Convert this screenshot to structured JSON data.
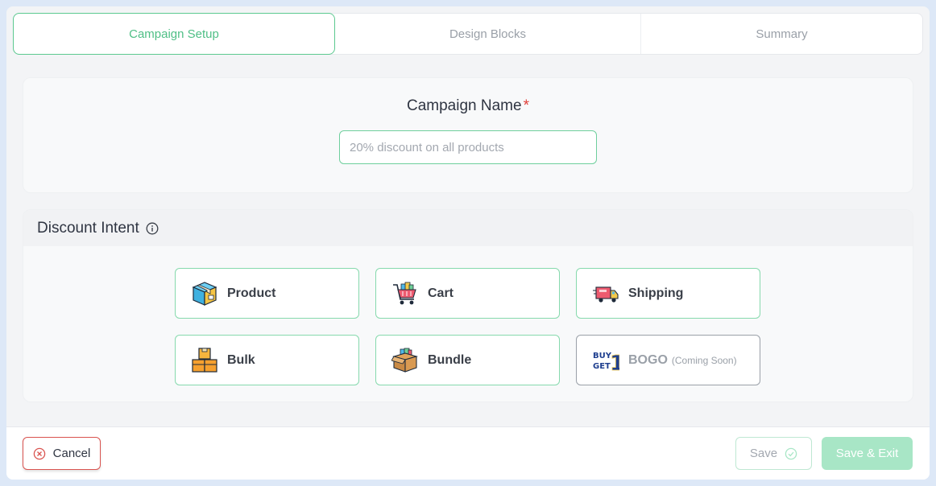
{
  "tabs": [
    {
      "label": "Campaign Setup",
      "active": true
    },
    {
      "label": "Design Blocks",
      "active": false
    },
    {
      "label": "Summary",
      "active": false
    }
  ],
  "campaign_name": {
    "label": "Campaign Name",
    "required_marker": "*",
    "placeholder": "20% discount on all products",
    "value": ""
  },
  "discount_intent": {
    "title": "Discount Intent",
    "info_icon": "info-icon",
    "options": [
      {
        "label": "Product",
        "icon": "product-box-icon",
        "note": ""
      },
      {
        "label": "Cart",
        "icon": "shopping-cart-icon",
        "note": ""
      },
      {
        "label": "Shipping",
        "icon": "delivery-truck-icon",
        "note": ""
      },
      {
        "label": "Bulk",
        "icon": "stacked-boxes-icon",
        "note": ""
      },
      {
        "label": "Bundle",
        "icon": "bundle-box-icon",
        "note": ""
      },
      {
        "label": "BOGO",
        "icon": "buy-get-one-icon",
        "note": "(Coming Soon)"
      }
    ]
  },
  "footer": {
    "cancel_label": "Cancel",
    "save_label": "Save",
    "save_exit_label": "Save & Exit"
  },
  "colors": {
    "accent": "#4fbf86",
    "danger": "#d9534f",
    "save_exit_bg": "#a8e6c6"
  }
}
